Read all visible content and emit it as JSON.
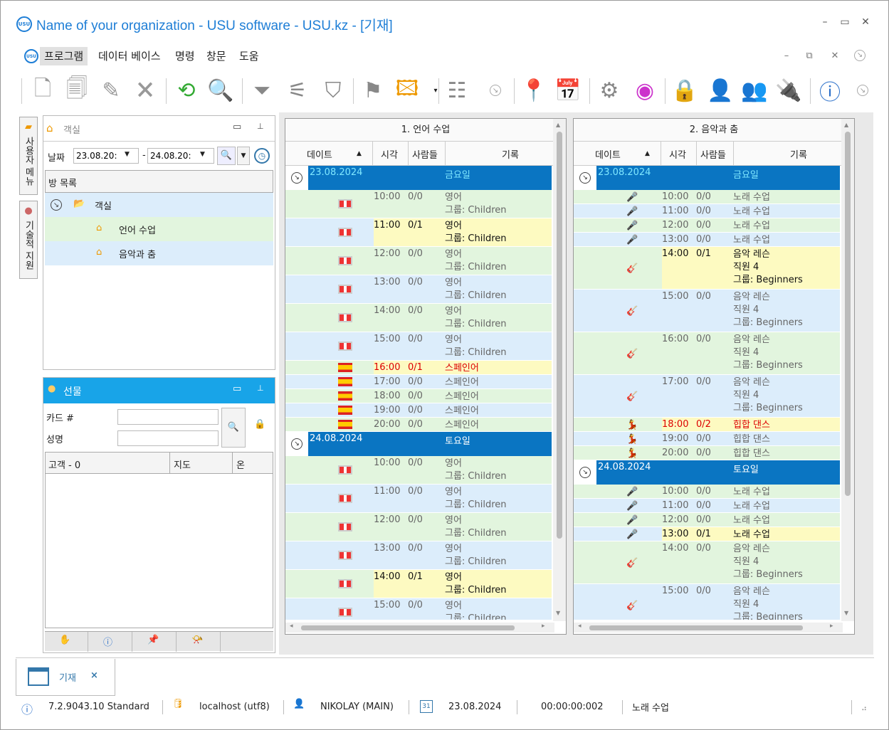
{
  "window": {
    "title": "Name of your organization - USU software - USU.kz - [기재]",
    "logo_text": "USU"
  },
  "menu": {
    "items": [
      "프로그램",
      "데이터 베이스",
      "명령",
      "창문",
      "도움"
    ]
  },
  "side_tabs": {
    "user_menu": "사용자 메뉴",
    "technical_support": "기술적 지원"
  },
  "rooms_panel": {
    "title": "객실",
    "date_label": "날짜",
    "date_from": "23.08.20:",
    "date_to": "24.08.20:",
    "dash": "-",
    "list_header": "방 목록",
    "tree": {
      "root": "객실",
      "children": [
        "언어 수업",
        "음악과 춤"
      ]
    }
  },
  "gift_panel": {
    "title": "선물",
    "card_label": "카드 #",
    "name_label": "성명",
    "columns": [
      "고객 - 0",
      "지도",
      "온"
    ]
  },
  "schedule_1": {
    "title": "1. 언어 수업",
    "columns": [
      "데이트",
      "시각",
      "사람들",
      "기록"
    ],
    "days": [
      {
        "date": "23.08.2024",
        "weekday": "금요일",
        "rows": [
          {
            "time": "10:00",
            "people": "0/0",
            "lines": [
              "영어",
              "그룹: Children"
            ],
            "flag": "uk"
          },
          {
            "time": "11:00",
            "people": "0/1",
            "lines": [
              "영어",
              "그룹: Children"
            ],
            "flag": "uk",
            "hl": true
          },
          {
            "time": "12:00",
            "people": "0/0",
            "lines": [
              "영어",
              "그룹: Children"
            ],
            "flag": "uk"
          },
          {
            "time": "13:00",
            "people": "0/0",
            "lines": [
              "영어",
              "그룹: Children"
            ],
            "flag": "uk"
          },
          {
            "time": "14:00",
            "people": "0/0",
            "lines": [
              "영어",
              "그룹: Children"
            ],
            "flag": "uk"
          },
          {
            "time": "15:00",
            "people": "0/0",
            "lines": [
              "영어",
              "그룹: Children"
            ],
            "flag": "uk"
          },
          {
            "time": "16:00",
            "people": "0/1",
            "lines": [
              "스페인어"
            ],
            "flag": "es",
            "hl": true,
            "red": true
          },
          {
            "time": "17:00",
            "people": "0/0",
            "lines": [
              "스페인어"
            ],
            "flag": "es"
          },
          {
            "time": "18:00",
            "people": "0/0",
            "lines": [
              "스페인어"
            ],
            "flag": "es"
          },
          {
            "time": "19:00",
            "people": "0/0",
            "lines": [
              "스페인어"
            ],
            "flag": "es"
          },
          {
            "time": "20:00",
            "people": "0/0",
            "lines": [
              "스페인어"
            ],
            "flag": "es"
          }
        ]
      },
      {
        "date": "24.08.2024",
        "weekday": "토요일",
        "rows": [
          {
            "time": "10:00",
            "people": "0/0",
            "lines": [
              "영어",
              "그룹: Children"
            ],
            "flag": "uk"
          },
          {
            "time": "11:00",
            "people": "0/0",
            "lines": [
              "영어",
              "그룹: Children"
            ],
            "flag": "uk"
          },
          {
            "time": "12:00",
            "people": "0/0",
            "lines": [
              "영어",
              "그룹: Children"
            ],
            "flag": "uk"
          },
          {
            "time": "13:00",
            "people": "0/0",
            "lines": [
              "영어",
              "그룹: Children"
            ],
            "flag": "uk"
          },
          {
            "time": "14:00",
            "people": "0/1",
            "lines": [
              "영어",
              "그룹: Children"
            ],
            "flag": "uk",
            "hl": true
          },
          {
            "time": "15:00",
            "people": "0/0",
            "lines": [
              "영어",
              "그룹: Children"
            ],
            "flag": "uk"
          }
        ]
      }
    ]
  },
  "schedule_2": {
    "title": "2. 음악과 춤",
    "columns": [
      "데이트",
      "시각",
      "사람들",
      "기록"
    ],
    "days": [
      {
        "date": "23.08.2024",
        "weekday": "금요일",
        "rows": [
          {
            "time": "10:00",
            "people": "0/0",
            "lines": [
              "노래 수업"
            ],
            "flag": "mic"
          },
          {
            "time": "11:00",
            "people": "0/0",
            "lines": [
              "노래 수업"
            ],
            "flag": "mic"
          },
          {
            "time": "12:00",
            "people": "0/0",
            "lines": [
              "노래 수업"
            ],
            "flag": "mic"
          },
          {
            "time": "13:00",
            "people": "0/0",
            "lines": [
              "노래 수업"
            ],
            "flag": "mic"
          },
          {
            "time": "14:00",
            "people": "0/1",
            "lines": [
              "음악 레슨",
              "직원 4",
              "그룹: Beginners"
            ],
            "flag": "guitar",
            "hl": true
          },
          {
            "time": "15:00",
            "people": "0/0",
            "lines": [
              "음악 레슨",
              "직원 4",
              "그룹: Beginners"
            ],
            "flag": "guitar"
          },
          {
            "time": "16:00",
            "people": "0/0",
            "lines": [
              "음악 레슨",
              "직원 4",
              "그룹: Beginners"
            ],
            "flag": "guitar"
          },
          {
            "time": "17:00",
            "people": "0/0",
            "lines": [
              "음악 레슨",
              "직원 4",
              "그룹: Beginners"
            ],
            "flag": "guitar"
          },
          {
            "time": "18:00",
            "people": "0/2",
            "lines": [
              "힙합 댄스"
            ],
            "flag": "dance",
            "hl": true,
            "red": true
          },
          {
            "time": "19:00",
            "people": "0/0",
            "lines": [
              "힙합 댄스"
            ],
            "flag": "dance"
          },
          {
            "time": "20:00",
            "people": "0/0",
            "lines": [
              "힙합 댄스"
            ],
            "flag": "dance"
          }
        ]
      },
      {
        "date": "24.08.2024",
        "weekday": "토요일",
        "rows": [
          {
            "time": "10:00",
            "people": "0/0",
            "lines": [
              "노래 수업"
            ],
            "flag": "mic"
          },
          {
            "time": "11:00",
            "people": "0/0",
            "lines": [
              "노래 수업"
            ],
            "flag": "mic"
          },
          {
            "time": "12:00",
            "people": "0/0",
            "lines": [
              "노래 수업"
            ],
            "flag": "mic"
          },
          {
            "time": "13:00",
            "people": "0/1",
            "lines": [
              "노래 수업"
            ],
            "flag": "mic",
            "hl": true
          },
          {
            "time": "14:00",
            "people": "0/0",
            "lines": [
              "음악 레슨",
              "직원 4",
              "그룹: Beginners"
            ],
            "flag": "guitar"
          },
          {
            "time": "15:00",
            "people": "0/0",
            "lines": [
              "음악 레슨",
              "직원 4",
              "그룹: Beginners"
            ],
            "flag": "guitar"
          }
        ]
      }
    ]
  },
  "doc_tab": {
    "label": "기재",
    "close": "×"
  },
  "status": {
    "version": "7.2.9043.10 Standard",
    "db": "localhost (utf8)",
    "user": "NIKOLAY (MAIN)",
    "cal_day": "31",
    "date": "23.08.2024",
    "timer": "00:00:00:002",
    "current": "노래 수업"
  }
}
